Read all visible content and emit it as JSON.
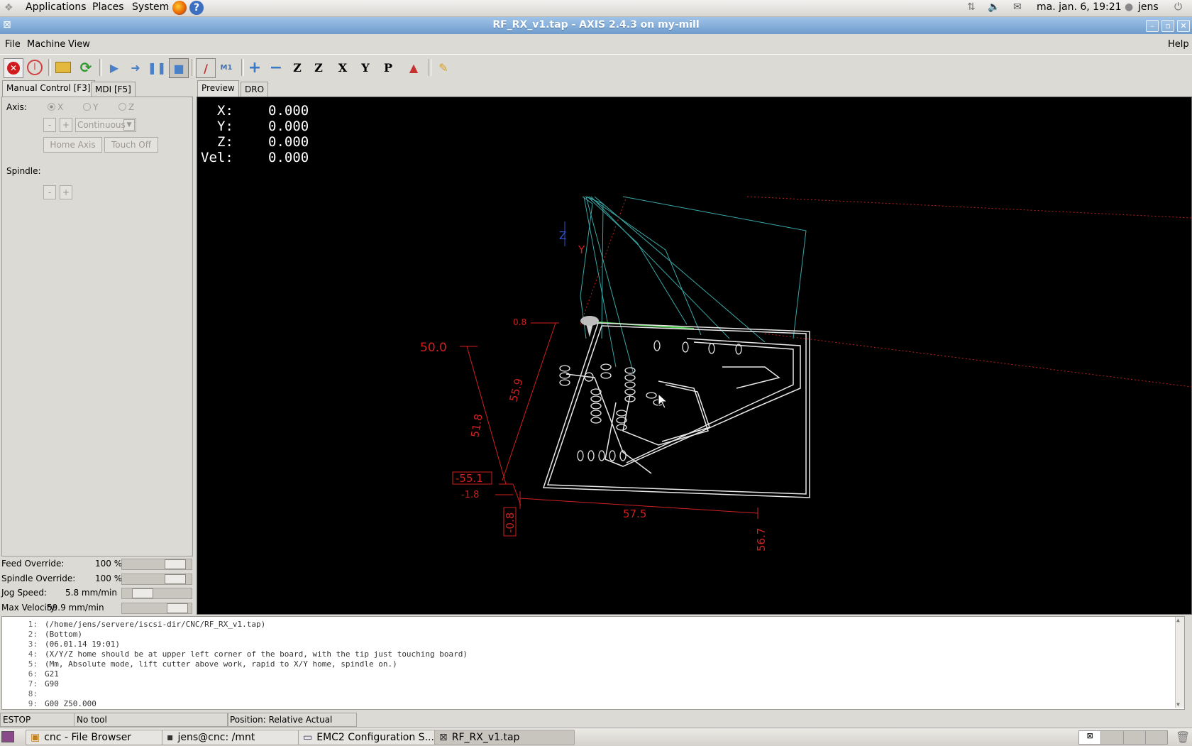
{
  "gnome_panel": {
    "menus": [
      "Applications",
      "Places",
      "System"
    ],
    "clock": "ma. jan.  6, 19:21",
    "user": "jens"
  },
  "window": {
    "title": "RF_RX_v1.tap - AXIS 2.4.3 on my-mill"
  },
  "menubar": {
    "items": [
      "File",
      "Machine",
      "View"
    ],
    "help": "Help"
  },
  "toolbar": {
    "icons": [
      "estop-icon",
      "machine-power-icon",
      "open-file-icon",
      "reload-icon",
      "run-icon",
      "step-icon",
      "pause-icon",
      "stop-icon",
      "block-delete-icon",
      "optional-stop-icon",
      "zoom-in-icon",
      "zoom-out-icon",
      "view-z-icon",
      "view-z2-icon",
      "view-x-icon",
      "view-y-icon",
      "view-p-icon",
      "rotate-view-icon",
      "clear-plot-icon"
    ]
  },
  "left_tabs": {
    "manual": "Manual Control [F3]",
    "mdi": "MDI [F5]"
  },
  "manual": {
    "axis_label": "Axis:",
    "axes": [
      "X",
      "Y",
      "Z"
    ],
    "minus": "-",
    "plus": "+",
    "jog_mode": "Continuous",
    "home_axis": "Home Axis",
    "touch_off": "Touch Off",
    "spindle_label": "Spindle:"
  },
  "overrides": {
    "feed_label": "Feed Override:",
    "feed_value": "100 %",
    "feed_fraction": 0.88,
    "spindle_label": "Spindle Override:",
    "spindle_value": "100 %",
    "spindle_fraction": 0.88,
    "jog_label": "Jog Speed:",
    "jog_value": "5.8 mm/min",
    "jog_fraction": 0.2,
    "maxvel_label": "Max Velocity:",
    "maxvel_value": "59.9 mm/min",
    "maxvel_fraction": 0.92
  },
  "preview_tabs": {
    "preview": "Preview",
    "dro": "DRO"
  },
  "dro": {
    "x_label": "X:",
    "x_value": "0.000",
    "y_label": "Y:",
    "y_value": "0.000",
    "z_label": "Z:",
    "z_value": "0.000",
    "vel_label": "Vel:",
    "vel_value": "0.000"
  },
  "dimensions": {
    "d1": "50.0",
    "d2": "0.8",
    "d3": "55.9",
    "d4": "51.8",
    "d5": "-55.1",
    "d6": "-1.8",
    "d7": "-0.8",
    "d8": "57.5",
    "d9": "56.7",
    "axis_y": "Y",
    "axis_z": "Z"
  },
  "code_lines": [
    {
      "n": "1:",
      "text": "(/home/jens/servere/iscsi-dir/CNC/RF_RX_v1.tap)"
    },
    {
      "n": "2:",
      "text": "(Bottom)"
    },
    {
      "n": "3:",
      "text": "(06.01.14 19:01)"
    },
    {
      "n": "4:",
      "text": "(X/Y/Z home should be at upper left corner of the board, with the tip just touching board)"
    },
    {
      "n": "5:",
      "text": "(Mm, Absolute mode, lift cutter above work, rapid to X/Y home, spindle on.)"
    },
    {
      "n": "6:",
      "text": "G21"
    },
    {
      "n": "7:",
      "text": "G90"
    },
    {
      "n": "8:",
      "text": ""
    },
    {
      "n": "9:",
      "text": "G00 Z50.000"
    }
  ],
  "status": {
    "estop": "ESTOP",
    "tool": "No tool",
    "position": "Position: Relative Actual"
  },
  "taskbar": {
    "tasks": [
      "cnc - File Browser",
      "jens@cnc: /mnt",
      "EMC2 Configuration S...",
      "RF_RX_v1.tap"
    ]
  }
}
